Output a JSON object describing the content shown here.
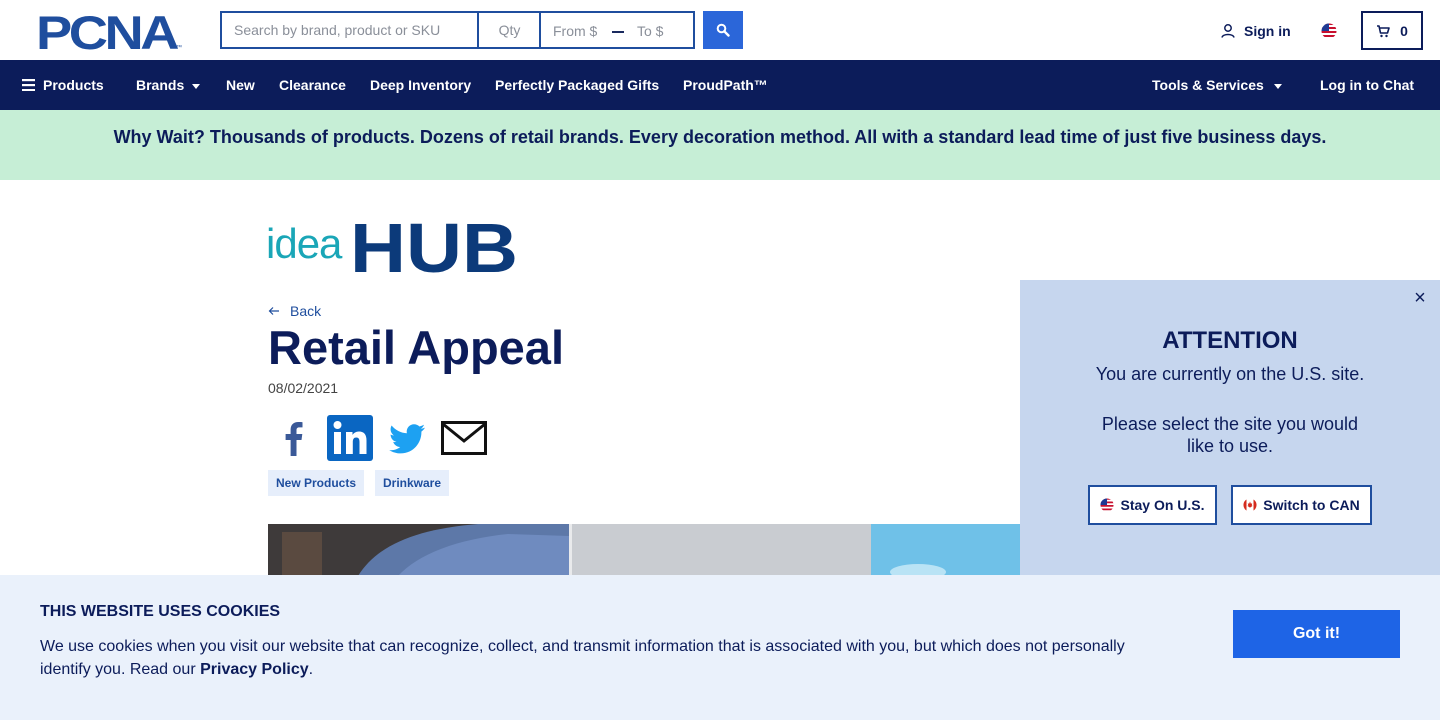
{
  "header": {
    "logo_text": "PCNA",
    "search_placeholder": "Search by brand, product or SKU",
    "qty_placeholder": "Qty",
    "price_from_placeholder": "From $",
    "price_to_placeholder": "To $",
    "sign_in_label": "Sign in",
    "cart_count": "0"
  },
  "nav": {
    "items": [
      {
        "label": "Products"
      },
      {
        "label": "Brands"
      },
      {
        "label": "New"
      },
      {
        "label": "Clearance"
      },
      {
        "label": "Deep Inventory"
      },
      {
        "label": "Perfectly Packaged Gifts"
      },
      {
        "label": "ProudPath™"
      }
    ],
    "tools_label": "Tools & Services",
    "chat_label": "Log in to Chat"
  },
  "promo": {
    "text": "Why Wait? Thousands of products. Dozens of retail brands. Every decoration method. All with a standard lead time of just five business days."
  },
  "article": {
    "brand_idea": "idea",
    "brand_hub": "HUB",
    "back_label": "Back",
    "title": "Retail Appeal",
    "date": "08/02/2021",
    "tags": [
      "New Products",
      "Drinkware"
    ]
  },
  "modal": {
    "title": "ATTENTION",
    "line1": "You are currently on the U.S. site.",
    "line2": "Please select the site you would like to use.",
    "stay_label": "Stay On U.S.",
    "switch_label": "Switch to CAN"
  },
  "cookies": {
    "title": "THIS WEBSITE USES COOKIES",
    "text": "We use cookies when you visit our website that can recognize, collect, and transmit information that is associated with you, but which does not personally identify you. Read our",
    "link_label": "Privacy Policy",
    "text_end": ".",
    "accept_label": "Got it!"
  },
  "colors": {
    "navy": "#0c1c5a",
    "accent_blue": "#2b66d9",
    "promo_green": "#c6eed6",
    "modal_blue": "#c6d6ee",
    "cookie_bg": "#eaf1fb",
    "teal": "#1aa6b7"
  }
}
